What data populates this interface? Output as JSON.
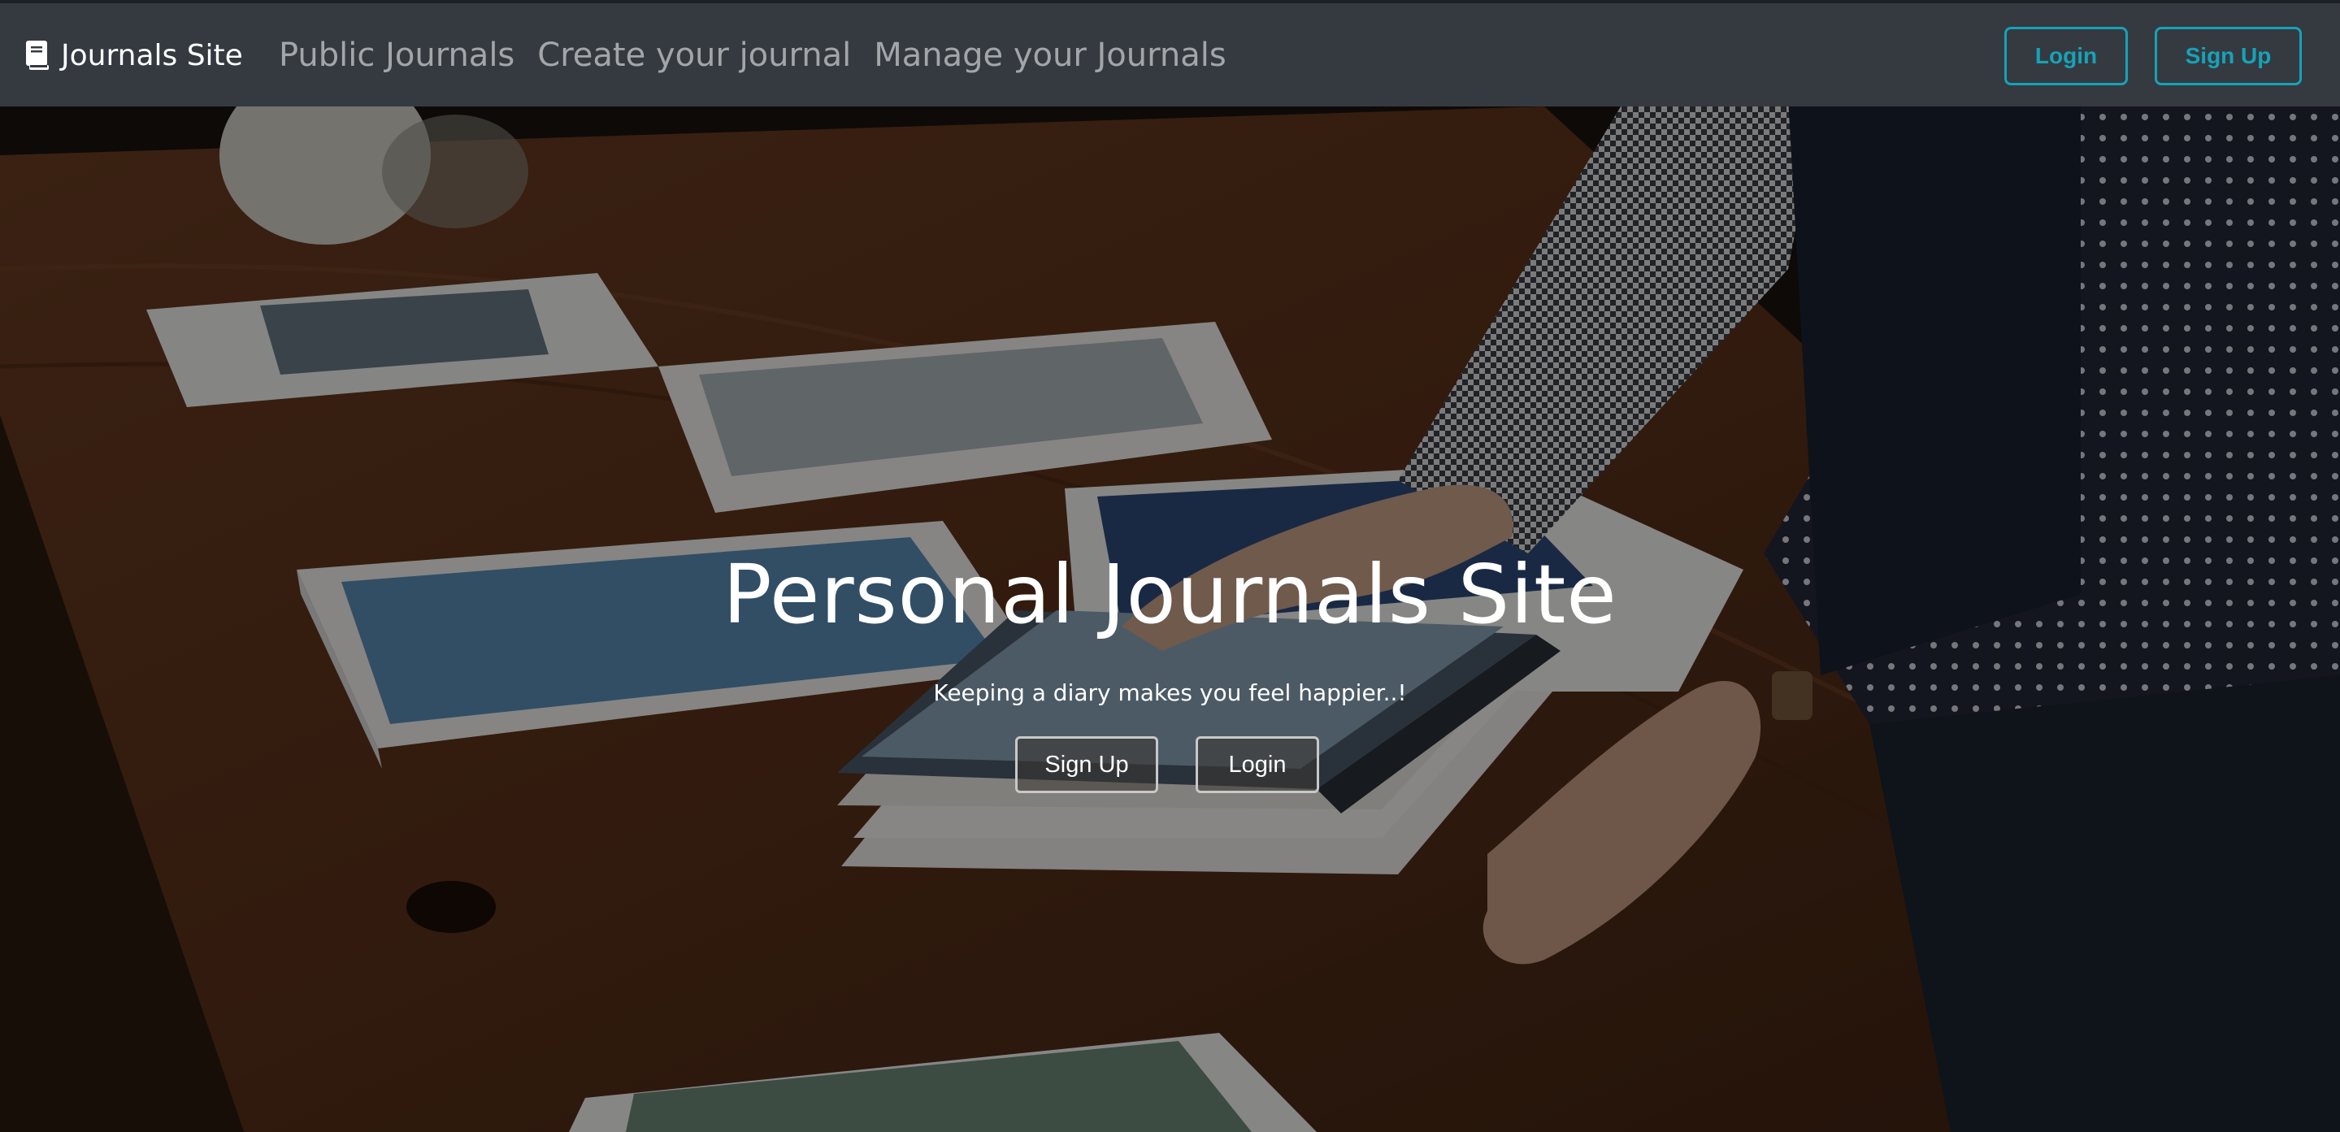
{
  "navbar": {
    "brand_icon": "book-icon",
    "brand_label": "Journals Site",
    "links": [
      {
        "label": "Public Journals"
      },
      {
        "label": "Create your journal"
      },
      {
        "label": "Manage your Journals"
      }
    ],
    "login_label": "Login",
    "signup_label": "Sign Up",
    "accent_color": "#17a2b8",
    "background_color": "#343a40"
  },
  "hero": {
    "title": "Personal Journals Site",
    "subtitle": "Keeping a diary makes you feel happier..!",
    "signup_label": "Sign Up",
    "login_label": "Login"
  }
}
